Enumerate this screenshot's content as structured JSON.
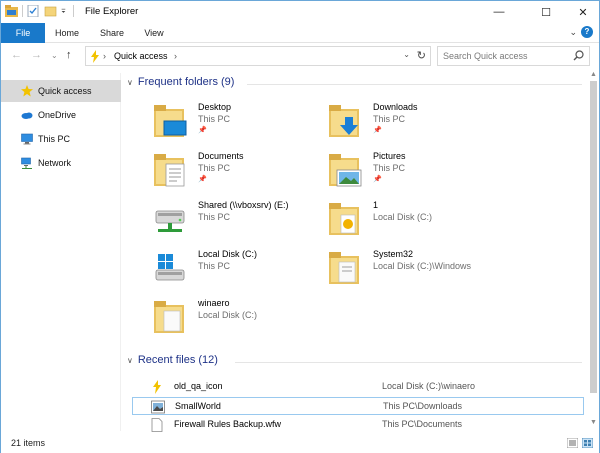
{
  "window": {
    "title": "File Explorer"
  },
  "window_controls": {
    "minimize": "—",
    "maximize": "☐",
    "close": "✕"
  },
  "ribbon": {
    "tabs": [
      "File",
      "Home",
      "Share",
      "View"
    ],
    "expand_glyph": "⌄",
    "help_glyph": "?"
  },
  "navigation": {
    "back_glyph": "←",
    "forward_glyph": "→",
    "recent_glyph": "⌄",
    "up_glyph": "↑",
    "breadcrumb": "Quick access",
    "refresh_glyph": "↻"
  },
  "search": {
    "placeholder": "Search Quick access"
  },
  "sidebar": {
    "items": [
      {
        "label": "Quick access",
        "icon": "star-icon",
        "active": true
      },
      {
        "label": "OneDrive",
        "icon": "cloud-icon"
      },
      {
        "label": "This PC",
        "icon": "computer-icon"
      },
      {
        "label": "Network",
        "icon": "network-icon"
      }
    ]
  },
  "frequent": {
    "title": "Frequent folders (9)",
    "caret": "∨",
    "folders": [
      {
        "name": "Desktop",
        "location": "This PC",
        "pinned": true,
        "icon": "desktop-folder-icon"
      },
      {
        "name": "Downloads",
        "location": "This PC",
        "pinned": true,
        "icon": "downloads-folder-icon"
      },
      {
        "name": "Documents",
        "location": "This PC",
        "pinned": true,
        "icon": "documents-folder-icon"
      },
      {
        "name": "Pictures",
        "location": "This PC",
        "pinned": true,
        "icon": "pictures-folder-icon"
      },
      {
        "name": "Shared (\\\\vboxsrv) (E:)",
        "location": "This PC",
        "pinned": false,
        "icon": "network-drive-icon"
      },
      {
        "name": "1",
        "location": "Local Disk (C:)",
        "pinned": false,
        "icon": "folder-icon"
      },
      {
        "name": "Local Disk (C:)",
        "location": "This PC",
        "pinned": false,
        "icon": "windows-drive-icon"
      },
      {
        "name": "System32",
        "location": "Local Disk (C:)\\Windows",
        "pinned": false,
        "icon": "folder-icon"
      },
      {
        "name": "winaero",
        "location": "Local Disk (C:)",
        "pinned": false,
        "icon": "folder-icon"
      }
    ]
  },
  "recent": {
    "title": "Recent files (12)",
    "caret": "∨",
    "files": [
      {
        "name": "old_qa_icon",
        "path": "Local Disk (C:)\\winaero",
        "icon": "lightning-file-icon",
        "selected": false
      },
      {
        "name": "SmallWorld",
        "path": "This PC\\Downloads",
        "icon": "image-file-icon",
        "selected": true
      },
      {
        "name": "Firewall Rules Backup.wfw",
        "path": "This PC\\Documents",
        "icon": "document-file-icon",
        "selected": false
      }
    ]
  },
  "pin_glyph": "📌",
  "status": {
    "items_count": "21 items"
  },
  "colors": {
    "accent": "#1979ca",
    "section_title": "#1e3287",
    "selection_border": "#99c9ef"
  }
}
